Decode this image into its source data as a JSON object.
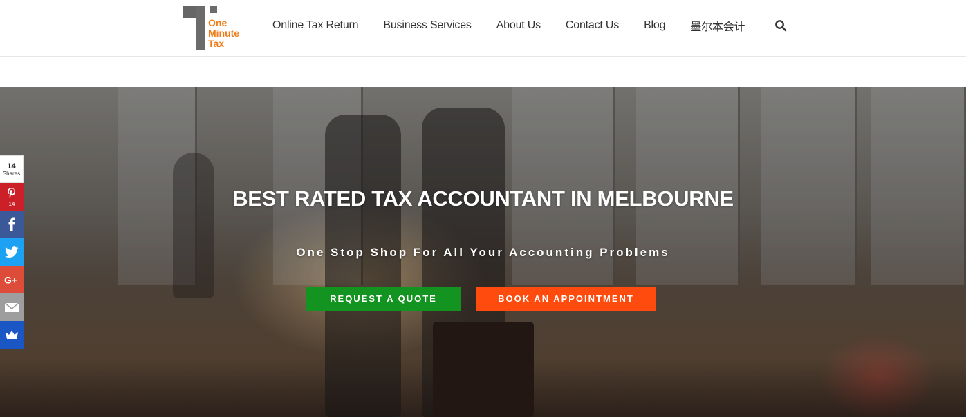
{
  "logo": {
    "line1": "One",
    "line2": "Minute",
    "line3": "Tax"
  },
  "nav": {
    "items": [
      {
        "label": "Online Tax Return"
      },
      {
        "label": "Business Services"
      },
      {
        "label": "About Us"
      },
      {
        "label": "Contact Us"
      },
      {
        "label": "Blog"
      },
      {
        "label": "墨尔本会计"
      }
    ],
    "search_icon": "search-icon"
  },
  "hero": {
    "title": "BEST RATED TAX ACCOUNTANT IN MELBOURNE",
    "subtitle": "One Stop Shop For All Your Accounting Problems",
    "quote_button": "REQUEST A QUOTE",
    "appointment_button": "BOOK AN APPOINTMENT"
  },
  "share": {
    "total_count": "14",
    "total_label": "Shares",
    "buttons": [
      {
        "name": "pinterest",
        "icon": "pinterest-icon",
        "count": "14",
        "color": "#cb2027"
      },
      {
        "name": "facebook",
        "icon": "facebook-icon",
        "count": "",
        "color": "#3b5998"
      },
      {
        "name": "twitter",
        "icon": "twitter-icon",
        "count": "",
        "color": "#1da1f2"
      },
      {
        "name": "google-plus",
        "icon": "google-plus-icon",
        "count": "",
        "color": "#dd4b39"
      },
      {
        "name": "email",
        "icon": "email-icon",
        "count": "",
        "color": "#9e9e9e"
      },
      {
        "name": "sumome",
        "icon": "crown-icon",
        "count": "",
        "color": "#1a56c4"
      }
    ]
  },
  "colors": {
    "brand_orange": "#f07d19",
    "logo_gray": "#6b6b6b",
    "quote_green": "#13931f",
    "appointment_orange": "#ff4c0e"
  }
}
